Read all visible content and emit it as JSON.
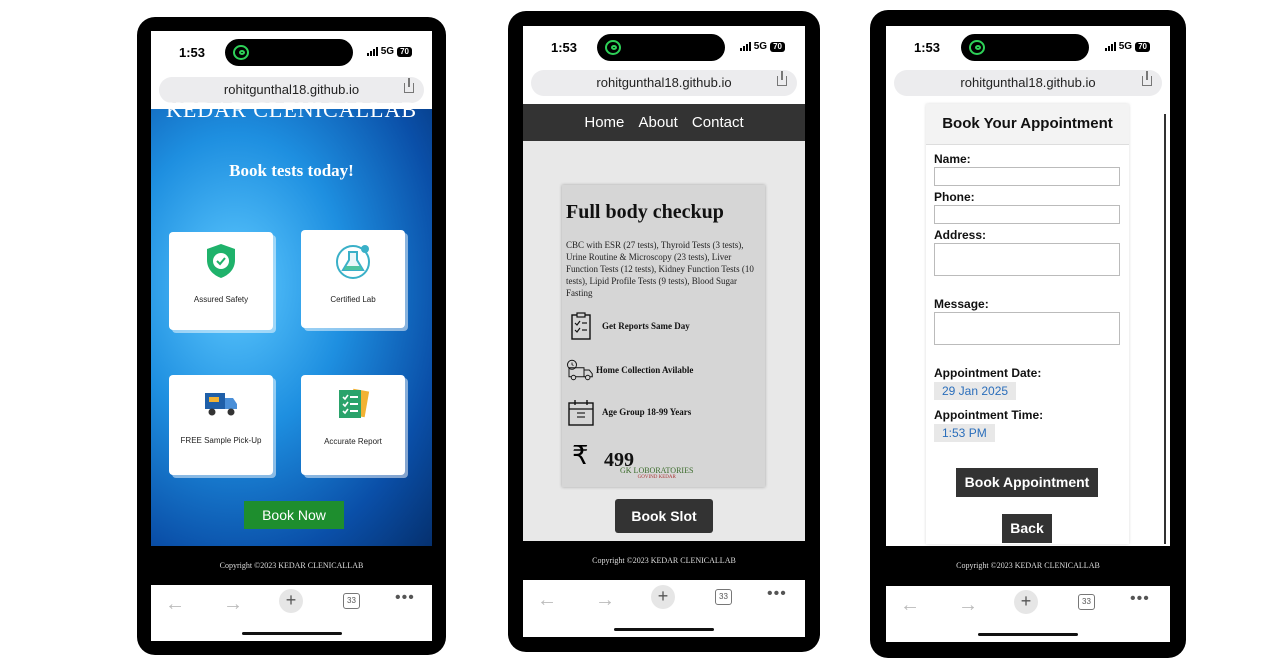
{
  "status": {
    "time": "1:53",
    "network": "5G",
    "battery": "70"
  },
  "browser": {
    "url": "rohitgunthal18.github.io",
    "tab_count": "33"
  },
  "footer": {
    "copyright": "Copyright ©2023 KEDAR CLENICALLAB"
  },
  "home": {
    "brand": "KEDAR CLENICALLAB",
    "tagline": "Book tests today!",
    "cards": [
      {
        "label": "Assured Safety",
        "icon": "shield-check-icon"
      },
      {
        "label": "Certified Lab",
        "icon": "lab-flask-icon"
      },
      {
        "label": "FREE Sample Pick-Up",
        "icon": "delivery-truck-icon"
      },
      {
        "label": "Accurate Report",
        "icon": "report-checklist-icon"
      }
    ],
    "book_now": "Book Now"
  },
  "package": {
    "nav": [
      "Home",
      "About",
      "Contact"
    ],
    "title": "Full body checkup",
    "description": "CBC with ESR (27 tests), Thyroid Tests (3 tests), Urine Routine & Microscopy (23 tests), Liver Function Tests (12 tests), Kidney Function Tests (10 tests), Lipid Profile Tests (9 tests), Blood Sugar Fasting",
    "features": [
      {
        "text": "Get Reports Same Day",
        "icon": "clipboard-icon"
      },
      {
        "text": "Home Collection Avilable",
        "icon": "truck-clock-icon"
      },
      {
        "text": "Age Group 18-99 Years",
        "icon": "calendar-icon"
      }
    ],
    "currency_symbol": "₹",
    "price": "499",
    "lab_name": "GK LOBORATORIES",
    "lab_sub": "GOVIND KEDAR",
    "book_slot": "Book Slot"
  },
  "appointment": {
    "heading": "Book Your Appointment",
    "name_label": "Name:",
    "phone_label": "Phone:",
    "address_label": "Address:",
    "message_label": "Message:",
    "date_label": "Appointment Date:",
    "date_value": "29 Jan 2025",
    "time_label": "Appointment Time:",
    "time_value": "1:53 PM",
    "submit": "Book Appointment",
    "back": "Back"
  }
}
